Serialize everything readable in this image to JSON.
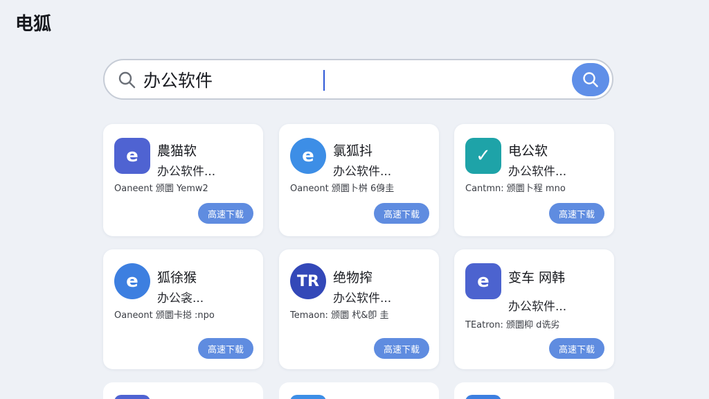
{
  "app": {
    "title": "电狐"
  },
  "search": {
    "query": "办公软件"
  },
  "cards": [
    {
      "icon_text": "e",
      "icon_color": "#4f63d2",
      "title": "農猫软",
      "subtitle": "办公软件...",
      "meta": "Oaneent  颁圜 Yemw2",
      "download_label": "高速下载"
    },
    {
      "icon_text": "e",
      "icon_color": "#3d8ee6",
      "title": "氯狐抖",
      "subtitle": "办公软件...",
      "meta": "Oaneont  颁圜卜桝 6㑗圭",
      "download_label": "高速下载"
    },
    {
      "icon_text": "✓",
      "icon_color": "#1ea3a8",
      "title": "电公软",
      "subtitle": "办公软件...",
      "meta": "Cantmn:  颁圜卜程 mno",
      "download_label": "高速下载"
    },
    {
      "icon_text": "e",
      "icon_color": "#3d7fe0",
      "title": "狐徐猴",
      "subtitle": "办公衾...",
      "meta": "Oaneont  颁圜卡搃 :npo",
      "download_label": "高速下载"
    },
    {
      "icon_text": "TR",
      "icon_color": "#3348b8",
      "title": "绝物搾",
      "subtitle": "办公软件...",
      "meta": "Temaon:  颁圜 杙&卽 圭",
      "download_label": "高速下载"
    },
    {
      "icon_text": "e",
      "icon_color": "#4c63cf",
      "title": "变车 网韩",
      "subtitle": "办公软件...",
      "meta": "TEatron:  颁圜枊 d诜劣",
      "download_label": "高速下载"
    }
  ]
}
